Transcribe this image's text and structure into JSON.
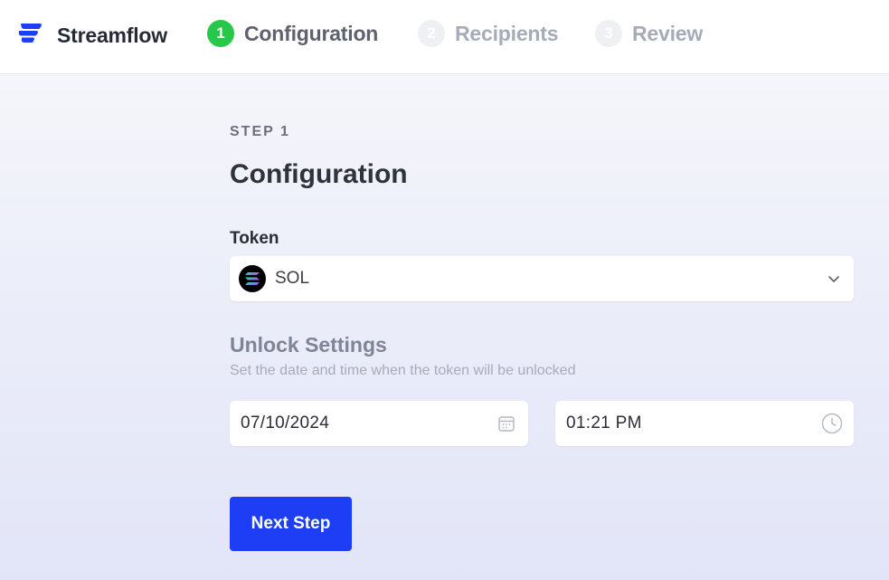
{
  "app": {
    "name": "Streamflow"
  },
  "steps": [
    {
      "number": "1",
      "label": "Configuration",
      "state": "active"
    },
    {
      "number": "2",
      "label": "Recipients",
      "state": "inactive"
    },
    {
      "number": "3",
      "label": "Review",
      "state": "inactive"
    }
  ],
  "form": {
    "eyebrow": "STEP 1",
    "title": "Configuration",
    "token_label": "Token",
    "token_value": "SOL",
    "token_icon": "solana-icon",
    "unlock_title": "Unlock Settings",
    "unlock_subtitle": "Set the date and time when the token will be unlocked",
    "date_value": "07/10/2024",
    "time_value": "01:21 PM",
    "next_label": "Next Step"
  },
  "colors": {
    "accent": "#1d3ef5",
    "step_active": "#27c84a",
    "brand": "#1d3ef5"
  }
}
